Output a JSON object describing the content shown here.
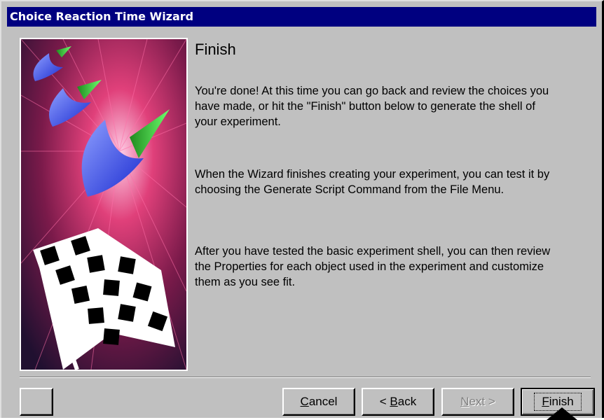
{
  "window": {
    "title": "Choice Reaction Time Wizard"
  },
  "content": {
    "heading": "Finish",
    "paragraphs": [
      "You're done!  At this time you can go back and review the choices you have made, or hit the \"Finish\" button below to generate the shell of your experiment.",
      "When the Wizard finishes creating your experiment, you can test it by choosing the Generate Script Command from the File Menu.",
      "After you have tested the basic experiment shell, you can then review the Properties for each object used in the experiment and customize them as you see fit."
    ]
  },
  "buttons": {
    "help": "",
    "cancel": {
      "mnemonic": "C",
      "rest": "ancel"
    },
    "back": {
      "prefix": "< ",
      "mnemonic": "B",
      "rest": "ack"
    },
    "next": {
      "mnemonic": "N",
      "rest": "ext >"
    },
    "finish": {
      "mnemonic": "F",
      "rest": "inish"
    },
    "next_enabled": false,
    "focused": "finish"
  },
  "colors": {
    "title_bar": "#000080",
    "face": "#c0c0c0",
    "image_accent_pink": "#c2185b",
    "image_accent_blue": "#2a3cff",
    "image_accent_green": "#39e639"
  },
  "icons": {
    "wizard_image": "fireworks-checkered-flag-graphic",
    "cursor": "mouse-pointer-icon"
  }
}
